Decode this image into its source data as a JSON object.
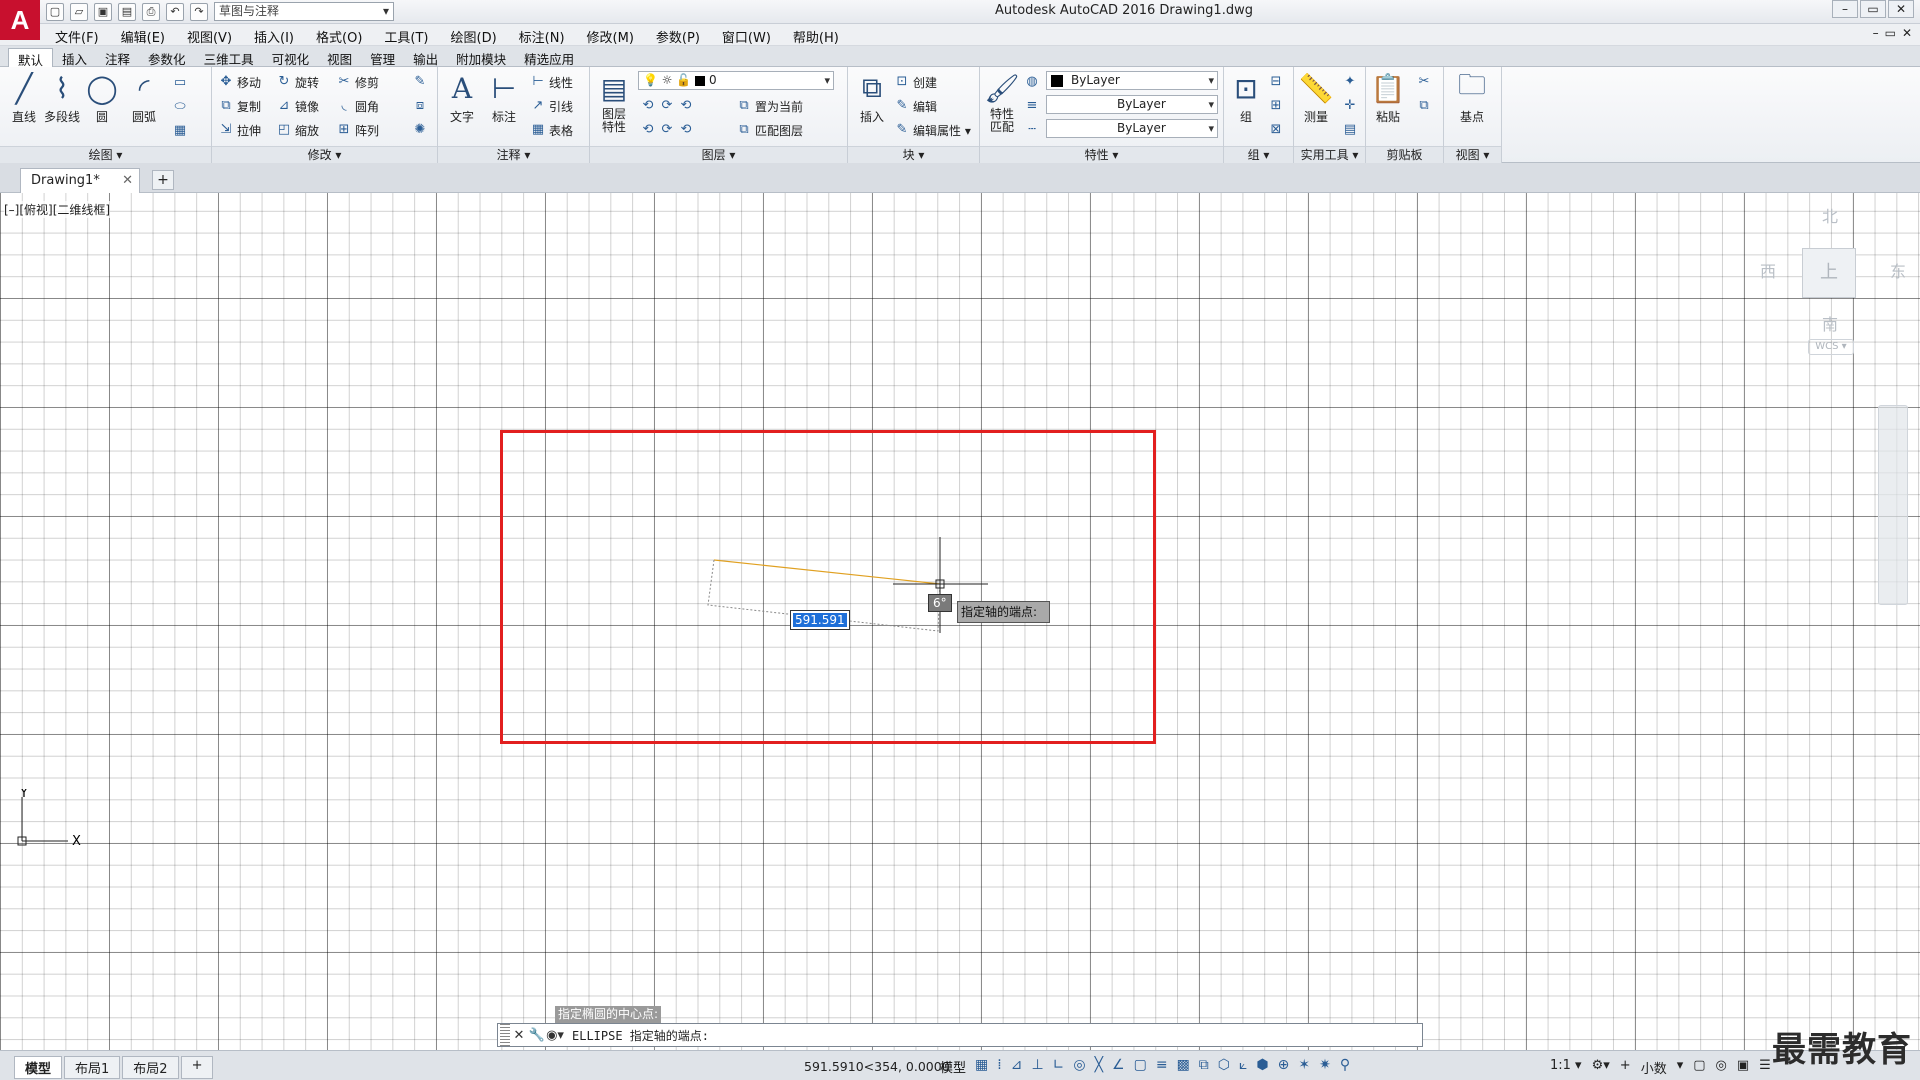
{
  "title_bar": {
    "app_logo": "A",
    "workspace": "草图与注释",
    "title": "Autodesk AutoCAD 2016    Drawing1.dwg",
    "win_min": "–",
    "win_max": "▭",
    "win_close": "✕"
  },
  "menu": {
    "items": [
      "文件(F)",
      "编辑(E)",
      "视图(V)",
      "插入(I)",
      "格式(O)",
      "工具(T)",
      "绘图(D)",
      "标注(N)",
      "修改(M)",
      "参数(P)",
      "窗口(W)",
      "帮助(H)"
    ],
    "doc_min": "–",
    "doc_max": "▭",
    "doc_close": "✕"
  },
  "ribbon_tabs": [
    "默认",
    "插入",
    "注释",
    "参数化",
    "三维工具",
    "可视化",
    "视图",
    "管理",
    "输出",
    "附加模块",
    "精选应用"
  ],
  "ribbon": {
    "draw": {
      "title": "绘图 ▾",
      "line": "直线",
      "polyline": "多段线",
      "circle": "圆",
      "arc": "圆弧"
    },
    "modify": {
      "title": "修改 ▾",
      "move": "移动",
      "rotate": "旋转",
      "trim": "修剪",
      "copy": "复制",
      "mirror": "镜像",
      "fillet": "圆角",
      "stretch": "拉伸",
      "scale": "缩放",
      "array": "阵列"
    },
    "annotation": {
      "title": "注释 ▾",
      "text": "文字",
      "dimension": "标注",
      "linear": "线性",
      "leader": "引线",
      "table": "表格"
    },
    "layers": {
      "title": "图层 ▾",
      "layer_props": "图层\n特性",
      "layer_value": "0",
      "set_current": "置为当前",
      "match_layer": "匹配图层"
    },
    "block": {
      "title": "块 ▾",
      "insert": "插入",
      "create": "创建",
      "edit": "编辑",
      "edit_attr": "编辑属性 ▾"
    },
    "properties": {
      "title": "特性 ▾",
      "match": "特性\n匹配",
      "color": "ByLayer",
      "linetype": "ByLayer",
      "lineweight": "ByLayer"
    },
    "groups": {
      "title": "组 ▾",
      "group": "组"
    },
    "utilities": {
      "title": "实用工具 ▾",
      "measure": "测量"
    },
    "clipboard": {
      "title": "剪贴板",
      "paste": "粘贴"
    },
    "view": {
      "title": "视图 ▾",
      "base": "基点"
    }
  },
  "file_tabs": {
    "active": "Drawing1*",
    "close": "✕",
    "add": "+"
  },
  "canvas": {
    "viewport_label": "[–][俯视][二维线框]",
    "angle_tooltip": "6°",
    "prompt_tooltip": "指定轴的端点:",
    "length_input": "591.591"
  },
  "viewcube": {
    "north": "北",
    "south": "南",
    "east": "东",
    "west": "西",
    "top": "上",
    "wcs": "WCS ▾"
  },
  "ucs": {
    "x": "X",
    "y": "Y"
  },
  "command": {
    "history": "指定椭圆的中心点:",
    "close": "✕",
    "settings": "🔧",
    "current": "ELLIPSE 指定轴的端点:"
  },
  "status": {
    "layouts": [
      "模型",
      "布局1",
      "布局2"
    ],
    "add_layout": "+",
    "coords": "591.5910<354, 0.0000",
    "model_label": "模型",
    "scale": "1:1 ▾",
    "units": "小数"
  },
  "watermark": "最需教育"
}
